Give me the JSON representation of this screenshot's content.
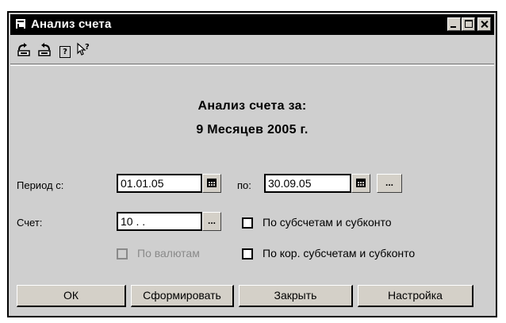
{
  "window": {
    "title": "Анализ счета"
  },
  "toolbar": {
    "icons": [
      "save-report-icon",
      "load-report-icon",
      "help-icon",
      "context-help-icon"
    ],
    "help_glyph": "?",
    "context_help_glyph": "↖?"
  },
  "report": {
    "heading_line1": "Анализ счета за:",
    "heading_line2": "9 Месяцев 2005 г."
  },
  "form": {
    "period_from_label": "Период с:",
    "period_from_value": "01.01.05",
    "period_to_label": "по:",
    "period_to_value": "30.09.05",
    "period_select_label": "...",
    "account_label": "Счет:",
    "account_value": "10 .  .",
    "account_select_label": "...",
    "subaccounts_label": "По субсчетам и субконто",
    "subaccounts_checked": false,
    "currency_label": "По валютам",
    "currency_checked": false,
    "currency_enabled": false,
    "corr_subaccounts_label": "По кор. субсчетам и субконто",
    "corr_subaccounts_checked": false
  },
  "buttons": {
    "ok": "ОК",
    "generate": "Сформировать",
    "close": "Закрыть",
    "settings": "Настройка"
  }
}
